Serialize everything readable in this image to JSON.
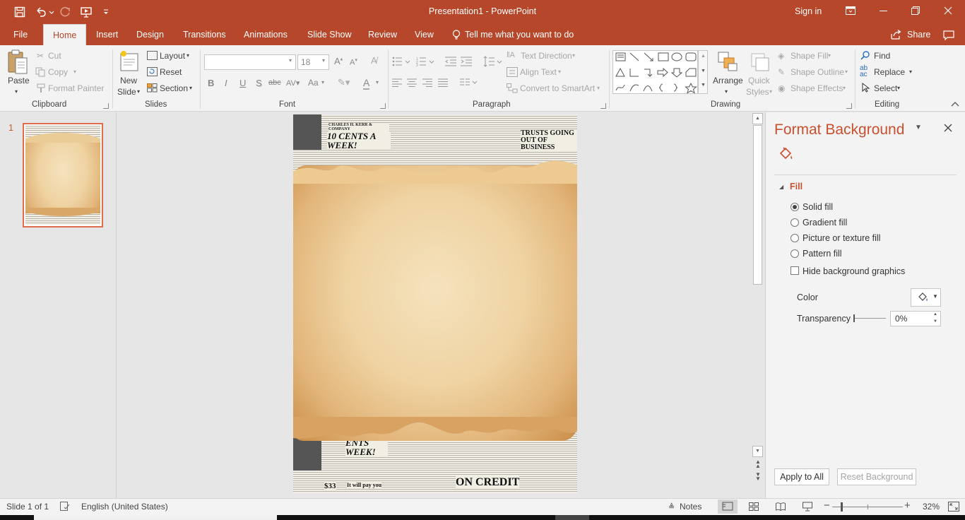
{
  "window": {
    "title": "Presentation1  -  PowerPoint",
    "signin": "Sign in",
    "quick_access": [
      "save-icon",
      "undo-icon",
      "redo-icon",
      "start-from-beginning-icon",
      "customize-icon"
    ]
  },
  "tabs": {
    "file": "File",
    "home": "Home",
    "insert": "Insert",
    "design": "Design",
    "transitions": "Transitions",
    "animations": "Animations",
    "slideshow": "Slide Show",
    "review": "Review",
    "view": "View",
    "tellme": "Tell me what you want to do",
    "share": "Share"
  },
  "ribbon": {
    "clipboard": {
      "label": "Clipboard",
      "paste": "Paste",
      "cut": "Cut",
      "copy": "Copy",
      "format_painter": "Format Painter"
    },
    "slides": {
      "label": "Slides",
      "new_slide_1": "New",
      "new_slide_2": "Slide",
      "layout": "Layout",
      "reset": "Reset",
      "section": "Section"
    },
    "font": {
      "label": "Font",
      "font_name": "",
      "font_size": "18",
      "bold": "B",
      "italic": "I",
      "underline": "U",
      "shadow": "S",
      "strike": "abc",
      "aa": "Aa",
      "font_color": "A"
    },
    "paragraph": {
      "label": "Paragraph",
      "text_direction": "Text Direction",
      "align_text": "Align Text",
      "smartart": "Convert to SmartArt"
    },
    "drawing": {
      "label": "Drawing",
      "arrange": "Arrange",
      "quick_styles_1": "Quick",
      "quick_styles_2": "Styles",
      "shape_fill": "Shape Fill",
      "shape_outline": "Shape Outline",
      "shape_effects": "Shape Effects"
    },
    "editing": {
      "label": "Editing",
      "find": "Find",
      "replace": "Replace",
      "select": "Select"
    }
  },
  "thumbnails": [
    {
      "number": "1"
    }
  ],
  "format_pane": {
    "title": "Format Background",
    "section": "Fill",
    "options": [
      {
        "label": "Solid fill",
        "selected": true
      },
      {
        "label": "Gradient fill",
        "selected": false
      },
      {
        "label": "Picture or texture fill",
        "selected": false
      },
      {
        "label": "Pattern fill",
        "selected": false
      }
    ],
    "hide_bg": "Hide background graphics",
    "color_label": "Color",
    "transparency_label": "Transparency",
    "transparency_value": "0%",
    "apply_all": "Apply to All",
    "reset_bg": "Reset Background"
  },
  "status": {
    "slide_of": "Slide 1 of 1",
    "language": "English (United States)",
    "notes": "Notes",
    "zoom": "32%"
  },
  "slide_text": {
    "top_right_head": "TRUSTS GOING OUT OF BUSINESS",
    "cents_week": "10 CENTS A WEEK!",
    "kerr": "CHARLES H. KERR & COMPANY",
    "bottom_credit": "ON CREDIT",
    "bottom_week": "ENTS WEEK!",
    "bottom_price": "$33",
    "bottom_pay": "It will pay you"
  }
}
